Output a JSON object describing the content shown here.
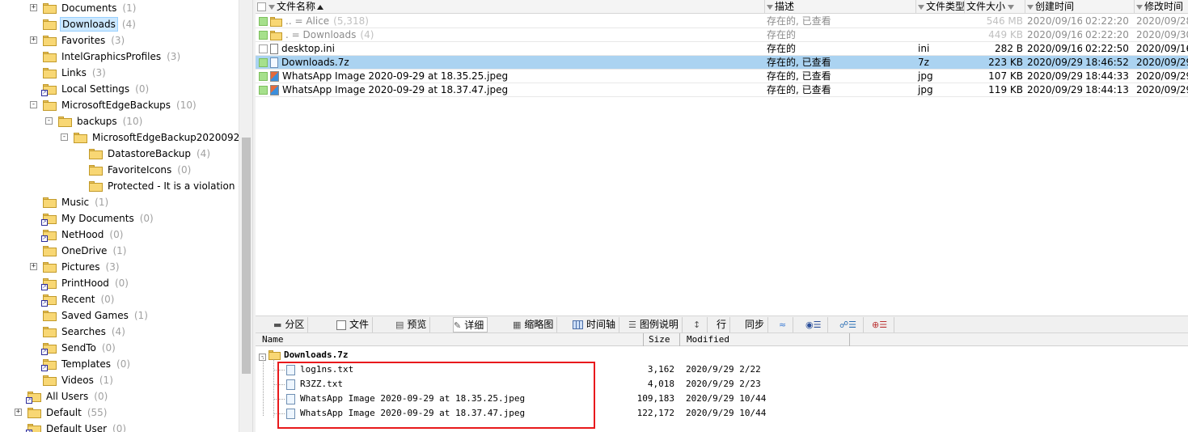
{
  "tree": {
    "items": [
      {
        "label": "Documents",
        "count": "(1)",
        "level": 1,
        "expander": "+",
        "link": false
      },
      {
        "label": "Downloads",
        "count": "(4)",
        "level": 1,
        "expander": "",
        "link": false,
        "selected": true
      },
      {
        "label": "Favorites",
        "count": "(3)",
        "level": 1,
        "expander": "+",
        "link": false
      },
      {
        "label": "IntelGraphicsProfiles",
        "count": "(3)",
        "level": 1,
        "expander": "",
        "link": false
      },
      {
        "label": "Links",
        "count": "(3)",
        "level": 1,
        "expander": "",
        "link": false
      },
      {
        "label": "Local Settings",
        "count": "(0)",
        "level": 1,
        "expander": "",
        "link": true
      },
      {
        "label": "MicrosoftEdgeBackups",
        "count": "(10)",
        "level": 1,
        "expander": "-",
        "link": false
      },
      {
        "label": "backups",
        "count": "(10)",
        "level": 2,
        "expander": "-",
        "link": false
      },
      {
        "label": "MicrosoftEdgeBackup20200928",
        "count": "",
        "level": 3,
        "expander": "-",
        "link": false
      },
      {
        "label": "DatastoreBackup",
        "count": "(4)",
        "level": 4,
        "expander": "",
        "link": false
      },
      {
        "label": "FavoriteIcons",
        "count": "(0)",
        "level": 4,
        "expander": "",
        "link": false
      },
      {
        "label": "Protected - It is a violation of",
        "count": "",
        "level": 4,
        "expander": "",
        "link": false
      },
      {
        "label": "Music",
        "count": "(1)",
        "level": 1,
        "expander": "",
        "link": false
      },
      {
        "label": "My Documents",
        "count": "(0)",
        "level": 1,
        "expander": "",
        "link": true
      },
      {
        "label": "NetHood",
        "count": "(0)",
        "level": 1,
        "expander": "",
        "link": true
      },
      {
        "label": "OneDrive",
        "count": "(1)",
        "level": 1,
        "expander": "",
        "link": false
      },
      {
        "label": "Pictures",
        "count": "(3)",
        "level": 1,
        "expander": "+",
        "link": false
      },
      {
        "label": "PrintHood",
        "count": "(0)",
        "level": 1,
        "expander": "",
        "link": true
      },
      {
        "label": "Recent",
        "count": "(0)",
        "level": 1,
        "expander": "",
        "link": true
      },
      {
        "label": "Saved Games",
        "count": "(1)",
        "level": 1,
        "expander": "",
        "link": false
      },
      {
        "label": "Searches",
        "count": "(4)",
        "level": 1,
        "expander": "",
        "link": false
      },
      {
        "label": "SendTo",
        "count": "(0)",
        "level": 1,
        "expander": "",
        "link": true
      },
      {
        "label": "Templates",
        "count": "(0)",
        "level": 1,
        "expander": "",
        "link": true
      },
      {
        "label": "Videos",
        "count": "(1)",
        "level": 1,
        "expander": "",
        "link": false
      },
      {
        "label": "All Users",
        "count": "(0)",
        "level": 0,
        "expander": "",
        "link": true
      },
      {
        "label": "Default",
        "count": "(55)",
        "level": 0,
        "expander": "+",
        "link": false
      },
      {
        "label": "Default User",
        "count": "(0)",
        "level": 0,
        "expander": "",
        "link": true
      }
    ]
  },
  "list": {
    "columns": {
      "name": "文件名称",
      "desc": "描述",
      "type": "文件类型",
      "size": "文件大小",
      "created": "创建时间",
      "modified": "修改时间"
    },
    "rows": [
      {
        "name": "..  =  Alice",
        "count": "(5,318)",
        "desc": "存在的, 已查看",
        "type": "",
        "size": "546 MB",
        "created_date": "2020/09/16",
        "created_time": "02:22:20",
        "modified": "2020/09/28",
        "kind": "parent",
        "dim": true
      },
      {
        "name": ".  =  Downloads",
        "count": "(4)",
        "desc": "存在的",
        "type": "",
        "size": "449 KB",
        "created_date": "2020/09/16",
        "created_time": "02:22:20",
        "modified": "2020/09/30",
        "kind": "self",
        "dim": true
      },
      {
        "name": "desktop.ini",
        "count": "",
        "desc": "存在的",
        "type": "ini",
        "size": "282 B",
        "created_date": "2020/09/16",
        "created_time": "02:22:50",
        "modified": "2020/09/16",
        "kind": "file"
      },
      {
        "name": "Downloads.7z",
        "count": "",
        "desc": "存在的, 已查看",
        "type": "7z",
        "size": "223 KB",
        "created_date": "2020/09/29",
        "created_time": "18:46:52",
        "modified": "2020/09/29",
        "kind": "archive",
        "selected": true
      },
      {
        "name": "WhatsApp Image 2020-09-29 at 18.35.25.jpeg",
        "count": "",
        "desc": "存在的, 已查看",
        "type": "jpg",
        "size": "107 KB",
        "created_date": "2020/09/29",
        "created_time": "18:44:33",
        "modified": "2020/09/29",
        "kind": "image"
      },
      {
        "name": "WhatsApp Image 2020-09-29 at 18.37.47.jpeg",
        "count": "",
        "desc": "存在的, 已查看",
        "type": "jpg",
        "size": "119 KB",
        "created_date": "2020/09/29",
        "created_time": "18:44:13",
        "modified": "2020/09/29",
        "kind": "image"
      }
    ]
  },
  "toolbar": {
    "partition": "分区",
    "file": "文件",
    "preview": "预览",
    "detail": "详细",
    "thumbnail": "缩略图",
    "timeline": "时间轴",
    "legend": "图例说明",
    "row": "行",
    "sync": "同步"
  },
  "preview": {
    "columns": {
      "name": "Name",
      "size": "Size",
      "modified": "Modified"
    },
    "archive": "Downloads.7z",
    "entries": [
      {
        "name": "log1ns.txt",
        "size": "3,162",
        "modified": "2020/9/29 2/22"
      },
      {
        "name": "R3ZZ.txt",
        "size": "4,018",
        "modified": "2020/9/29 2/23"
      },
      {
        "name": "WhatsApp Image 2020-09-29 at 18.35.25.jpeg",
        "size": "109,183",
        "modified": "2020/9/29 10/44"
      },
      {
        "name": "WhatsApp Image 2020-09-29 at 18.37.47.jpeg",
        "size": "122,172",
        "modified": "2020/9/29 10/44"
      }
    ]
  }
}
